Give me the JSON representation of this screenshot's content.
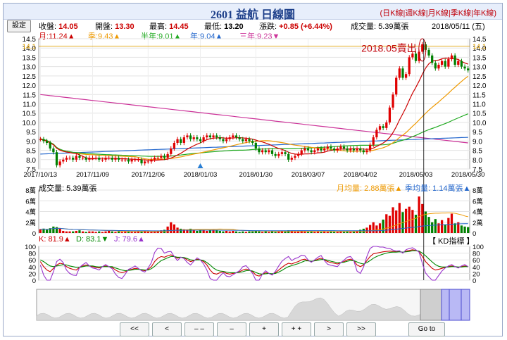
{
  "header": {
    "title": "2601 益航  日線圖",
    "links": [
      "日K線",
      "週K線",
      "月K線",
      "季K線",
      "年K線"
    ]
  },
  "settings_label": "設定",
  "quote": {
    "close_label": "收盤:",
    "close": "14.05",
    "open_label": "開盤:",
    "open": "13.30",
    "high_label": "最高:",
    "high": "14.45",
    "low_label": "最低:",
    "low": "13.20",
    "change_label": "漲跌:",
    "change": "+0.85 (+6.44%)",
    "volume_label": "成交量:",
    "volume": "5.39萬張",
    "date": "2018/05/11 (五)"
  },
  "ma_legend": {
    "month": "月:11.24▲",
    "quarter": "季:9.43▲",
    "half": "半年:9.01▲",
    "year": "年:9.04▲",
    "three_year": "三年:9.23▼"
  },
  "volume_legend": {
    "total": "成交量: 5.39萬張",
    "month_avg": "月均量: 2.88萬張▲",
    "quarter_avg": "季均量: 1.14萬張▲"
  },
  "kd_legend": {
    "k": "K: 81.9▲",
    "d": "D: 83.1▼",
    "j": "J: 79.6▲",
    "name": "【 KD指標 】"
  },
  "annotation": "2018.05賣出",
  "colors": {
    "up": "#e00000",
    "down": "#008000",
    "month_ma": "#cc0000",
    "quarter_ma": "#ee9900",
    "half_ma": "#22aa22",
    "year_ma": "#2266cc",
    "three_year_ma": "#cc3399",
    "k": "#cc0000",
    "d": "#008800",
    "j": "#9933cc"
  },
  "nav": [
    "<<",
    "<",
    "– –",
    "–",
    "+",
    "+ +",
    ">",
    ">>",
    "Go to"
  ],
  "chart_data": [
    {
      "type": "candlestick",
      "title": "2601 益航 日線圖",
      "x_ticks": [
        "2017/10/13",
        "2017/11/09",
        "2017/12/06",
        "2018/01/03",
        "2018/01/30",
        "2018/03/07",
        "2018/04/02",
        "2018/05/03",
        "2018/05/30"
      ],
      "y_ticks": [
        7.5,
        8.0,
        8.5,
        9.0,
        9.5,
        10.0,
        10.5,
        11.0,
        11.5,
        12.0,
        12.5,
        13.0,
        13.5,
        14.0,
        14.5
      ],
      "ylim": [
        7.5,
        14.5
      ],
      "current_price_marker": 14.1,
      "closes": [
        9.1,
        9.0,
        8.9,
        8.6,
        8.4,
        7.7,
        7.9,
        8.0,
        8.1,
        8.1,
        8.0,
        8.2,
        8.1,
        8.1,
        8.0,
        8.1,
        8.1,
        8.1,
        8.0,
        8.0,
        8.1,
        8.1,
        8.0,
        8.1,
        8.0,
        8.0,
        8.0,
        7.9,
        8.0,
        8.0,
        8.0,
        7.8,
        7.9,
        7.9,
        8.0,
        8.1,
        8.1,
        8.2,
        8.1,
        8.3,
        8.6,
        8.9,
        9.1,
        8.9,
        9.2,
        9.3,
        9.1,
        9.2,
        9.1,
        9.0,
        9.2,
        9.3,
        9.2,
        9.3,
        9.2,
        9.1,
        9.0,
        9.1,
        9.2,
        9.3,
        9.2,
        9.1,
        9.0,
        9.1,
        9.0,
        8.9,
        8.6,
        8.4,
        8.5,
        8.4,
        8.5,
        8.3,
        8.2,
        8.3,
        8.4,
        8.3,
        8.0,
        8.1,
        8.2,
        8.3,
        8.5,
        8.6,
        8.5,
        8.4,
        8.5,
        8.6,
        8.5,
        8.6,
        8.7,
        8.6,
        8.5,
        8.6,
        8.7,
        8.6,
        8.5,
        8.6,
        8.5,
        8.6,
        8.5,
        8.4,
        8.5,
        8.8,
        9.2,
        9.6,
        9.8,
        9.7,
        10.0,
        10.8,
        11.5,
        12.4,
        12.9,
        12.4,
        12.6,
        13.5,
        13.7,
        13.3,
        13.8,
        14.2,
        13.9,
        13.6,
        13.2,
        12.9,
        13.1,
        13.3,
        13.0,
        13.4,
        13.6,
        13.1,
        13.3,
        13.0,
        12.9,
        12.8
      ],
      "event_marker": "2018/01/03"
    },
    {
      "type": "bar",
      "title": "成交量",
      "y_ticks": [
        "0",
        "2萬",
        "4萬",
        "6萬",
        "8萬"
      ],
      "ylim": [
        0,
        8
      ],
      "values": [
        0.7,
        0.8,
        0.6,
        0.9,
        1.2,
        1.1,
        0.8,
        0.4,
        0.3,
        0.3,
        0.3,
        0.4,
        0.5,
        0.3,
        0.2,
        0.3,
        0.3,
        0.2,
        0.3,
        0.2,
        0.3,
        0.4,
        0.3,
        0.2,
        0.3,
        0.2,
        0.3,
        0.3,
        0.2,
        0.2,
        0.3,
        0.3,
        0.4,
        0.3,
        0.2,
        0.3,
        0.4,
        0.5,
        0.6,
        1.2,
        2.0,
        1.6,
        1.0,
        0.8,
        0.7,
        0.6,
        0.8,
        0.5,
        0.4,
        0.6,
        0.5,
        0.4,
        0.5,
        0.6,
        0.5,
        0.4,
        0.3,
        0.4,
        0.3,
        0.4,
        0.3,
        0.2,
        0.3,
        0.2,
        0.3,
        0.3,
        0.4,
        0.3,
        0.2,
        0.3,
        0.2,
        0.3,
        0.2,
        0.3,
        0.4,
        0.3,
        0.5,
        0.4,
        0.3,
        0.3,
        0.4,
        0.3,
        0.2,
        0.3,
        0.2,
        0.3,
        0.2,
        0.3,
        0.2,
        0.3,
        0.2,
        0.2,
        0.3,
        0.2,
        0.3,
        0.2,
        0.3,
        0.4,
        0.6,
        0.8,
        1.0,
        1.5,
        2.0,
        1.4,
        1.8,
        2.5,
        3.5,
        3.2,
        4.8,
        4.2,
        5.6,
        3.9,
        4.5,
        4.9,
        4.3,
        3.4,
        6.8,
        5.4,
        4.0,
        3.0,
        2.0,
        2.6,
        1.8,
        2.4,
        1.6,
        2.8,
        3.6,
        1.8,
        2.0,
        1.4,
        1.2,
        1.1
      ]
    },
    {
      "type": "line",
      "title": "KD指標",
      "y_ticks": [
        0,
        20,
        40,
        60,
        80,
        100
      ],
      "ylim": [
        0,
        100
      ],
      "series": [
        {
          "name": "K",
          "values": [
            55,
            40,
            30,
            25,
            35,
            45,
            50,
            48,
            40,
            35,
            32,
            30,
            38,
            42,
            45,
            42,
            40,
            38,
            36,
            40,
            42,
            40,
            38,
            30,
            25,
            22,
            25,
            30,
            32,
            35,
            33,
            30,
            28,
            32,
            40,
            55,
            65,
            70,
            68,
            72,
            75,
            70,
            65,
            68,
            66,
            60,
            55,
            58,
            62,
            60,
            55,
            45,
            30,
            20,
            18,
            22,
            25,
            20,
            18,
            20,
            22,
            25,
            30,
            33,
            30,
            25,
            15,
            12,
            18,
            22,
            20,
            18,
            22,
            30,
            38,
            45,
            50,
            48,
            52,
            55,
            60,
            62,
            58,
            55,
            58,
            62,
            65,
            60,
            55,
            52,
            50,
            48,
            52,
            55,
            60,
            62,
            58,
            45,
            40,
            45,
            58,
            70,
            78,
            80,
            82,
            84,
            85,
            86,
            85,
            84,
            85,
            82,
            86,
            88,
            90,
            88,
            85,
            70,
            55,
            45,
            35,
            30,
            32,
            35,
            38,
            40,
            42,
            40,
            38,
            40,
            42,
            40
          ]
        },
        {
          "name": "D",
          "values": [
            60,
            55,
            48,
            42,
            40,
            42,
            44,
            46,
            45,
            42,
            40,
            38,
            38,
            40,
            42,
            42,
            42,
            40,
            39,
            40,
            40,
            40,
            40,
            36,
            33,
            30,
            28,
            29,
            30,
            32,
            32,
            31,
            30,
            30,
            34,
            41,
            50,
            58,
            62,
            66,
            70,
            70,
            68,
            68,
            67,
            64,
            60,
            59,
            60,
            60,
            58,
            52,
            45,
            36,
            30,
            27,
            26,
            24,
            22,
            22,
            22,
            23,
            25,
            28,
            29,
            27,
            23,
            19,
            18,
            19,
            20,
            19,
            20,
            24,
            29,
            35,
            40,
            43,
            46,
            49,
            53,
            57,
            57,
            56,
            57,
            59,
            61,
            61,
            59,
            56,
            54,
            52,
            52,
            53,
            56,
            58,
            58,
            54,
            50,
            48,
            52,
            58,
            65,
            70,
            74,
            77,
            80,
            82,
            83,
            83,
            84,
            83,
            84,
            85,
            87,
            87,
            86,
            80,
            72,
            63,
            54,
            46,
            41,
            39,
            39,
            39,
            40,
            40,
            39,
            39,
            40,
            40
          ]
        },
        {
          "name": "J",
          "values": [
            45,
            15,
            0,
            0,
            25,
            55,
            62,
            52,
            30,
            20,
            15,
            14,
            38,
            46,
            52,
            42,
            36,
            34,
            30,
            40,
            46,
            40,
            34,
            18,
            8,
            5,
            18,
            32,
            36,
            42,
            35,
            28,
            24,
            36,
            52,
            82,
            95,
            94,
            80,
            84,
            85,
            70,
            58,
            68,
            64,
            52,
            45,
            56,
            66,
            60,
            48,
            30,
            5,
            0,
            0,
            12,
            22,
            12,
            10,
            16,
            22,
            28,
            40,
            43,
            32,
            20,
            0,
            0,
            18,
            28,
            20,
            15,
            26,
            42,
            56,
            64,
            70,
            58,
            64,
            67,
            74,
            72,
            60,
            53,
            60,
            68,
            73,
            58,
            47,
            44,
            42,
            40,
            52,
            59,
            68,
            70,
            58,
            27,
            20,
            39,
            70,
            94,
            100,
            100,
            98,
            98,
            95,
            94,
            89,
            86,
            87,
            80,
            90,
            94,
            96,
            90,
            83,
            50,
            21,
            10,
            0,
            0,
            14,
            27,
            36,
            42,
            46,
            40,
            36,
            42,
            46,
            40
          ]
        }
      ]
    }
  ]
}
